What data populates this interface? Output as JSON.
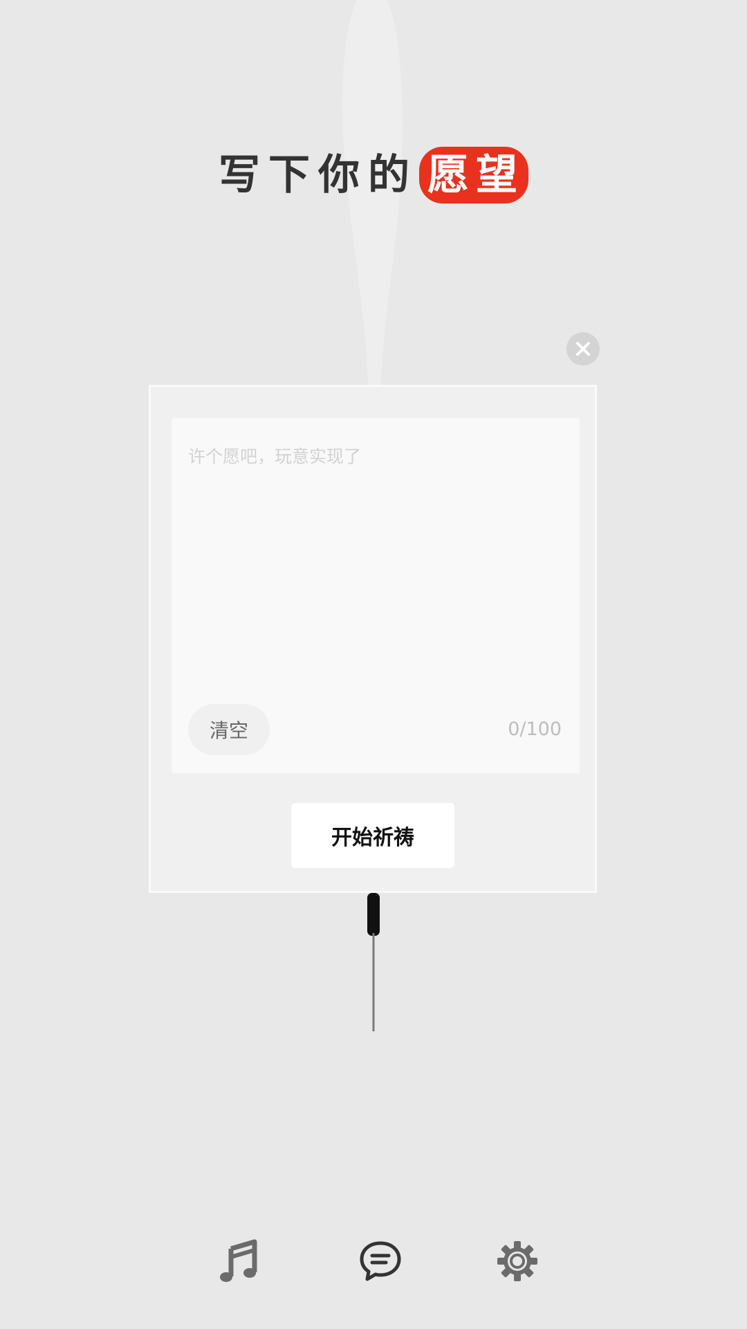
{
  "title": {
    "prefix": "写下你的",
    "highlight": "愿望"
  },
  "wish_card": {
    "input_placeholder": "许个愿吧，玩意实现了",
    "input_value": "",
    "clear_label": "清空",
    "char_count": "0/100",
    "start_label": "开始祈祷"
  },
  "bottom_nav": {
    "items": [
      {
        "icon": "music-note-icon"
      },
      {
        "icon": "chat-bubble-icon"
      },
      {
        "icon": "gear-icon"
      }
    ]
  },
  "colors": {
    "background": "#e8e8e8",
    "accent": "#e8321d",
    "title_text": "#333333"
  }
}
